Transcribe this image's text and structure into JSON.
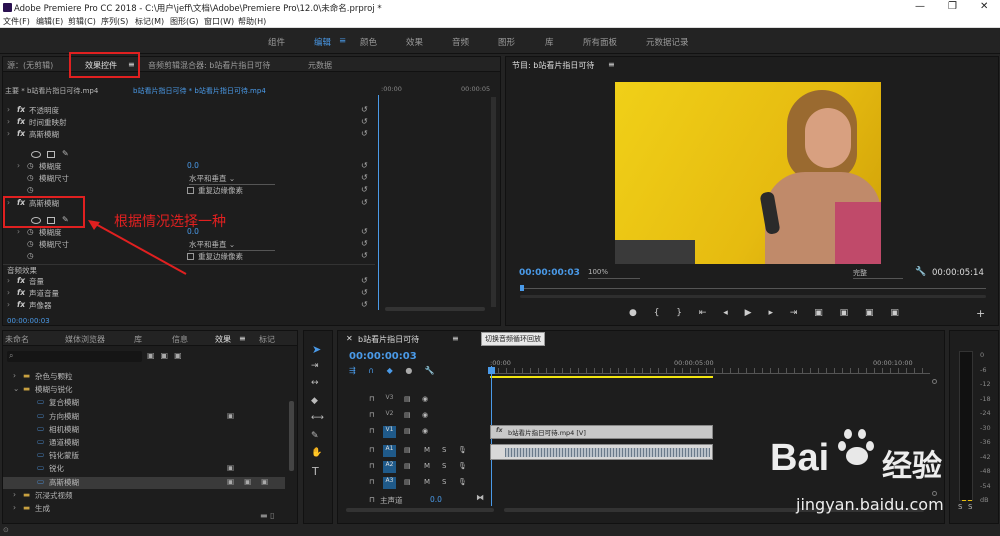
{
  "titlebar": {
    "title": "Adobe Premiere Pro CC 2018 - C:\\用户\\jeff\\文档\\Adobe\\Premiere Pro\\12.0\\未命名.prproj *",
    "min": "—",
    "max": "❐",
    "close": "✕"
  },
  "menu": [
    "文件(F)",
    "编辑(E)",
    "剪辑(C)",
    "序列(S)",
    "标记(M)",
    "图形(G)",
    "窗口(W)",
    "帮助(H)"
  ],
  "workspaces": [
    "组件",
    "编辑",
    "颜色",
    "效果",
    "音频",
    "图形",
    "库",
    "所有面板",
    "元数据记录"
  ],
  "workspace_active_mark": "≡",
  "source_panel": {
    "tabs": [
      "源：(无剪辑)",
      "效果控件",
      "音频剪辑混合器: b站看片指日可待",
      "元数据"
    ],
    "tab_menu": "≡",
    "master": "主要 * b站看片指日可待.mp4",
    "clip": "b站看片指日可待 * b站看片指日可待.mp4",
    "t_start": ":00:00",
    "t_end": "00:00:05",
    "rows": [
      {
        "label": "不透明度",
        "kind": "fx"
      },
      {
        "label": "时间重映射",
        "kind": "fx"
      },
      {
        "label": "高斯模糊",
        "kind": "fx"
      },
      {
        "label": "模糊度",
        "value": "0.0",
        "kind": "param"
      },
      {
        "label": "模糊尺寸",
        "value": "水平和垂直",
        "kind": "select"
      },
      {
        "label": "重复边缘像素",
        "kind": "check"
      },
      {
        "label": "高斯模糊",
        "kind": "fx"
      },
      {
        "label": "模糊度",
        "value": "0.0",
        "kind": "param"
      },
      {
        "label": "模糊尺寸",
        "value": "水平和垂直",
        "kind": "select"
      },
      {
        "label": "重复边缘像素",
        "kind": "check"
      },
      {
        "label": "音频效果",
        "kind": "section"
      },
      {
        "label": "音量",
        "kind": "fx"
      },
      {
        "label": "声道音量",
        "kind": "fx"
      },
      {
        "label": "声像器",
        "kind": "fx"
      }
    ],
    "fx_label": "fx",
    "timecode": "00:00:00:03"
  },
  "annotation": "根据情况选择一种",
  "program_panel": {
    "title": "节目: b站看片指日可待",
    "menu": "≡",
    "timecode": "00:00:00:03",
    "zoom": "100%",
    "quality": "完整",
    "duration": "00:00:05:14"
  },
  "project_panel": {
    "tabs": [
      "未命名",
      "媒体浏览器",
      "库",
      "信息",
      "效果",
      "标记"
    ],
    "tab_menu": "≡",
    "tree": [
      {
        "label": "杂色与颗粒",
        "level": 1
      },
      {
        "label": "模糊与锐化",
        "level": 1,
        "open": true
      },
      {
        "label": "复合模糊",
        "level": 2
      },
      {
        "label": "方向模糊",
        "level": 2,
        "badge": true
      },
      {
        "label": "相机模糊",
        "level": 2
      },
      {
        "label": "通道模糊",
        "level": 2
      },
      {
        "label": "钝化蒙版",
        "level": 2
      },
      {
        "label": "锐化",
        "level": 2,
        "badge": true
      },
      {
        "label": "高斯模糊",
        "level": 2,
        "badge3": true,
        "selected": true
      },
      {
        "label": "沉浸式视频",
        "level": 1
      },
      {
        "label": "生成",
        "level": 1
      }
    ]
  },
  "timeline": {
    "title": "b站看片指日可待",
    "menu": "≡",
    "timecode": "00:00:00:03",
    "tooltip": "切换音频循环回放",
    "ruler": [
      ":00:00",
      "00:00:05:00",
      "00:00:10:00"
    ],
    "tracks_v": [
      "V3",
      "V2",
      "V1"
    ],
    "tracks_a": [
      "A1",
      "A2",
      "A3"
    ],
    "master": "主声道",
    "master_val": "0.0",
    "clip_label": "b站看片指日可待.mp4 [V]",
    "fx_label": "fx",
    "btn_m": "M",
    "btn_s": "S",
    "lock": "🔒"
  },
  "meter": {
    "labels": [
      "0",
      "-6",
      "-12",
      "-18",
      "-24",
      "-30",
      "-36",
      "-42",
      "-48",
      "-54",
      "dB"
    ],
    "s1": "S",
    "s2": "S"
  },
  "watermark": {
    "brand_a": "Bai",
    "brand_b": "经验",
    "url": "jingyan.baidu.com"
  },
  "colors": {
    "accent": "#4a9ae8",
    "red": "#e02020",
    "yellow": "#f2e510"
  }
}
